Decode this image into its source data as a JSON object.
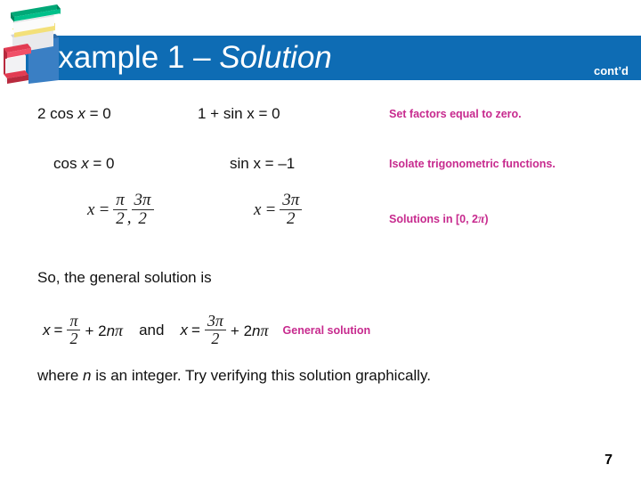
{
  "slide": {
    "title_prefix": "Example 1 – ",
    "title_emphasis": "Solution",
    "contd_label": "cont’d",
    "page_number": "7",
    "accent_blue": "#0e6cb4",
    "accent_magenta": "#c72a8e"
  },
  "icons": {
    "book_stack": "book-stack-icon"
  },
  "equations": {
    "row1": {
      "left": "2 cos x = 0",
      "left_parts": {
        "coef": "2 cos ",
        "var": "x",
        "rhs": " = 0"
      },
      "right": "1 + sin x = 0",
      "right_parts": {
        "lhs": "1 + sin x = 0"
      }
    },
    "row2": {
      "left": "cos x =  0",
      "left_parts": {
        "fn": "cos ",
        "var": "x",
        "rhs": " =  0"
      },
      "right": "sin x = –1"
    },
    "row3": {
      "left": {
        "var": "x",
        "eq": "=",
        "fraction_1": {
          "num": "π",
          "den": "2"
        },
        "separator": ",",
        "fraction_2": {
          "num": "3π",
          "den": "2"
        }
      },
      "right": {
        "var": "x",
        "eq": "=",
        "fraction": {
          "num": "3π",
          "den": "2"
        }
      }
    }
  },
  "notes": {
    "note1": "Set factors equal to zero.",
    "note2": "Isolate trigonometric functions.",
    "note3_prefix": "Solutions in [0, 2",
    "note3_pi": "π",
    "note3_suffix": ")",
    "general_solution_label": "General solution"
  },
  "body": {
    "lead_in": "So, the general solution is",
    "general": {
      "left": {
        "var": "x",
        "eq": "=",
        "fraction": {
          "num": "π",
          "den": "2"
        },
        "tail_plus": "+ 2",
        "tail_n": "n",
        "tail_pi": "π"
      },
      "conjunction": "and",
      "right": {
        "var": "x",
        "eq": "=",
        "fraction": {
          "num": "3π",
          "den": "2"
        },
        "tail_plus": "+ 2",
        "tail_n": "n",
        "tail_pi": "π"
      }
    },
    "closing_pre": "where ",
    "closing_var": "n",
    "closing_post": " is an integer. Try verifying this solution graphically."
  }
}
